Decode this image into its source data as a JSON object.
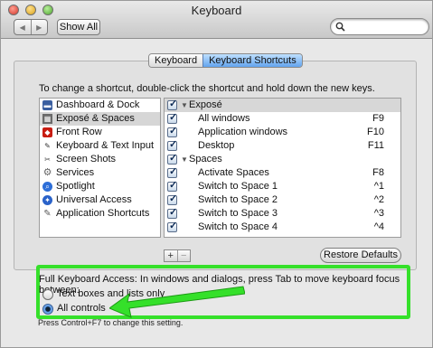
{
  "window": {
    "title": "Keyboard",
    "toolbar": {
      "back_icon": "◀",
      "forward_icon": "▶",
      "show_all_label": "Show All",
      "search_value": "",
      "search_placeholder": ""
    }
  },
  "tabs": [
    {
      "label": "Keyboard",
      "active": false
    },
    {
      "label": "Keyboard Shortcuts",
      "active": true
    }
  ],
  "hint": "To change a shortcut, double-click the shortcut and hold down the new keys.",
  "categories": [
    {
      "label": "Dashboard & Dock",
      "icon": "dashboard-dock-icon",
      "selected": false
    },
    {
      "label": "Exposé & Spaces",
      "icon": "expose-spaces-icon",
      "selected": true
    },
    {
      "label": "Front Row",
      "icon": "front-row-icon",
      "selected": false
    },
    {
      "label": "Keyboard & Text Input",
      "icon": "keyboard-text-input-icon",
      "selected": false
    },
    {
      "label": "Screen Shots",
      "icon": "screen-shots-icon",
      "selected": false
    },
    {
      "label": "Services",
      "icon": "services-icon",
      "selected": false
    },
    {
      "label": "Spotlight",
      "icon": "spotlight-icon",
      "selected": false
    },
    {
      "label": "Universal Access",
      "icon": "universal-access-icon",
      "selected": false
    },
    {
      "label": "Application Shortcuts",
      "icon": "application-shortcuts-icon",
      "selected": false
    }
  ],
  "shortcuts": [
    {
      "type": "group",
      "label": "Exposé",
      "checked": true
    },
    {
      "type": "item",
      "label": "All windows",
      "key": "F9",
      "checked": true
    },
    {
      "type": "item",
      "label": "Application windows",
      "key": "F10",
      "checked": true
    },
    {
      "type": "item",
      "label": "Desktop",
      "key": "F11",
      "checked": true
    },
    {
      "type": "group",
      "label": "Spaces",
      "checked": true
    },
    {
      "type": "item",
      "label": "Activate Spaces",
      "key": "F8",
      "checked": true
    },
    {
      "type": "item",
      "label": "Switch to Space 1",
      "key": "^1",
      "checked": true
    },
    {
      "type": "item",
      "label": "Switch to Space 2",
      "key": "^2",
      "checked": true
    },
    {
      "type": "item",
      "label": "Switch to Space 3",
      "key": "^3",
      "checked": true
    },
    {
      "type": "item",
      "label": "Switch to Space 4",
      "key": "^4",
      "checked": true
    }
  ],
  "add_label": "+",
  "remove_label": "−",
  "restore_defaults_label": "Restore Defaults",
  "full_keyboard_access": {
    "label": "Full Keyboard Access: In windows and dialogs, press Tab to move keyboard focus between:",
    "options": [
      {
        "label": "Text boxes and lists only",
        "selected": false
      },
      {
        "label": "All controls",
        "selected": true
      }
    ],
    "footnote": "Press Control+F7 to change this setting.",
    "highlight_color": "#35e02a"
  }
}
